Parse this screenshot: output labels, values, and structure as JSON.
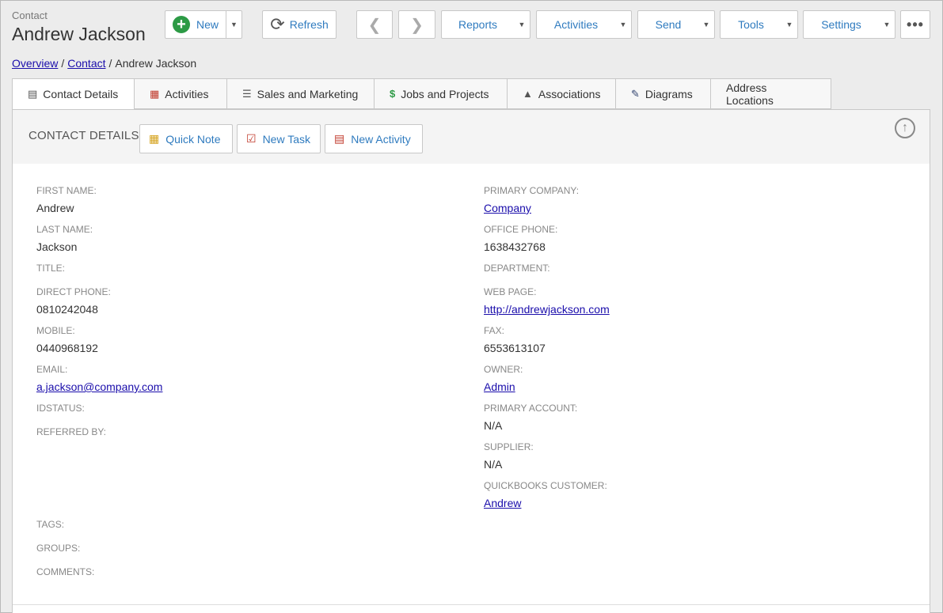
{
  "header": {
    "entity_type": "Contact",
    "record_title": "Andrew Jackson"
  },
  "toolbar": {
    "new_label": "New",
    "refresh_label": "Refresh",
    "reports_label": "Reports",
    "activities_label": "Activities",
    "send_label": "Send",
    "tools_label": "Tools",
    "settings_label": "Settings",
    "more_label": "•••"
  },
  "breadcrumb": {
    "items": [
      "Overview",
      "Contact",
      "Andrew Jackson"
    ],
    "separator": "/"
  },
  "tabs": [
    {
      "label": "Contact Details",
      "icon": "contact-card-icon"
    },
    {
      "label": "Activities",
      "icon": "calendar-icon"
    },
    {
      "label": "Sales and Marketing",
      "icon": "coins-icon"
    },
    {
      "label": "Jobs and Projects",
      "icon": "dollar-doc-icon"
    },
    {
      "label": "Associations",
      "icon": "hierarchy-icon"
    },
    {
      "label": "Diagrams",
      "icon": "pencil-icon"
    },
    {
      "label": "Address Locations",
      "icon": ""
    }
  ],
  "section": {
    "title": "CONTACT DETAILS",
    "quick_note_label": "Quick Note",
    "new_task_label": "New Task",
    "new_activity_label": "New Activity"
  },
  "fields_left": {
    "first_name": {
      "label": "FIRST NAME:",
      "value": "Andrew"
    },
    "last_name": {
      "label": "LAST NAME:",
      "value": "Jackson"
    },
    "title": {
      "label": "TITLE:",
      "value": ""
    },
    "direct_phone": {
      "label": "DIRECT PHONE:",
      "value": "0810242048"
    },
    "mobile": {
      "label": "MOBILE:",
      "value": "0440968192"
    },
    "email": {
      "label": "EMAIL:",
      "value": "a.jackson@company.com"
    },
    "idstatus": {
      "label": "IDSTATUS:",
      "value": ""
    },
    "referred_by": {
      "label": "REFERRED BY:",
      "value": ""
    },
    "tags": {
      "label": "TAGS:",
      "value": ""
    },
    "groups": {
      "label": "GROUPS:",
      "value": ""
    },
    "comments": {
      "label": "COMMENTS:",
      "value": ""
    }
  },
  "fields_right": {
    "primary_company": {
      "label": "PRIMARY COMPANY:",
      "value": "Company"
    },
    "office_phone": {
      "label": "OFFICE PHONE:",
      "value": "1638432768"
    },
    "department": {
      "label": "DEPARTMENT:",
      "value": ""
    },
    "web_page": {
      "label": "WEB PAGE:",
      "value": "http://andrewjackson.com"
    },
    "fax": {
      "label": "FAX:",
      "value": "6553613107"
    },
    "owner": {
      "label": "OWNER:",
      "value": "Admin"
    },
    "primary_account": {
      "label": "PRIMARY ACCOUNT:",
      "value": "N/A"
    },
    "supplier": {
      "label": "SUPPLIER:",
      "value": "N/A"
    },
    "quickbooks_customer": {
      "label": "QUICKBOOKS CUSTOMER:",
      "value": "Andrew"
    }
  },
  "colors": {
    "accent": "#2f7bbf",
    "link": "#1a0dab",
    "new_icon": "#2c9a45"
  }
}
